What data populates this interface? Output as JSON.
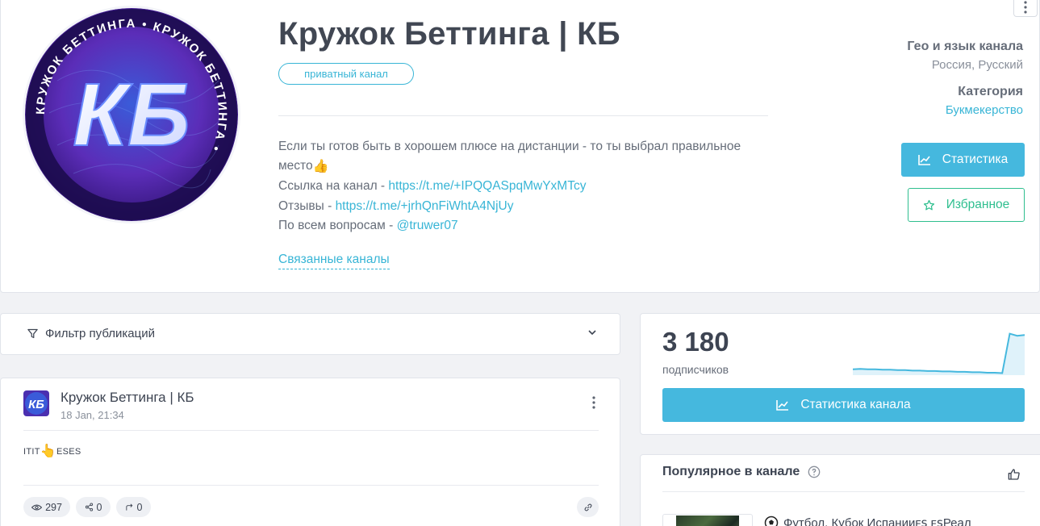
{
  "channel": {
    "title": "Кружок Беттинга | КБ",
    "badge": "приватный канал",
    "description_lines": [
      {
        "text": "Если ты готов быть в хорошем плюсе на дистанции - то ты выбрал правильное"
      },
      {
        "text": "место",
        "emoji": "👍"
      },
      {
        "text": "Ссылка на канал - ",
        "link": "https://t.me/+IPQQASpqMwYxMTcy"
      },
      {
        "text": "Отзывы - ",
        "link": "https://t.me/+jrhQnFiWhtA4NjUy"
      },
      {
        "text": "По всем вопросам - ",
        "link": "@truwer07"
      }
    ],
    "related_link": "Связанные каналы",
    "avatar_initials": "КБ",
    "avatar_ring_text": "КРУЖОК БЕТТИНГА • КРУЖОК БЕТТИНГА •"
  },
  "meta": {
    "geo_label": "Гео и язык канала",
    "geo_value": "Россия, Русский",
    "category_label": "Категория",
    "category_value": "Букмекерство"
  },
  "actions": {
    "stats_label": "Статистика",
    "favorite_label": "Избранное"
  },
  "filter": {
    "label": "Фильтр публикаций"
  },
  "post": {
    "author": "Кружок Беттинга | КБ",
    "date": "18 Jan, 21:34",
    "text_before": "ITIT",
    "text_emoji": "👆",
    "text_after": "ESES",
    "views": "297",
    "shares": "0",
    "forwards": "0"
  },
  "subscribers": {
    "count": "3 180",
    "label": "подписчиков",
    "button_label": "Статистика канала",
    "trend": [
      0.1,
      0.11,
      0.1,
      0.1,
      0.09,
      0.09,
      0.08,
      0.08,
      0.07,
      0.07,
      0.06,
      0.06,
      0.05,
      0.05,
      0.04,
      0.04,
      0.03,
      0.03,
      0.02,
      0.02,
      0.01,
      0.95,
      0.9,
      0.92
    ]
  },
  "popular": {
    "title": "Популярное в канале",
    "item_text": "Футбол. Кубок Испанииᴇꜱ ᴇꜱРеал"
  },
  "colors": {
    "accent": "#45b8de",
    "link": "#38b5d6",
    "favorite": "#2fbf8f"
  },
  "icons": [
    "more-vertical-icon",
    "chart-line-icon",
    "star-icon",
    "filter-icon",
    "chevron-down-icon",
    "eye-icon",
    "share-icon",
    "forward-icon",
    "link-icon",
    "help-circle-icon",
    "thumbs-up-icon",
    "soccer-ball-icon"
  ]
}
